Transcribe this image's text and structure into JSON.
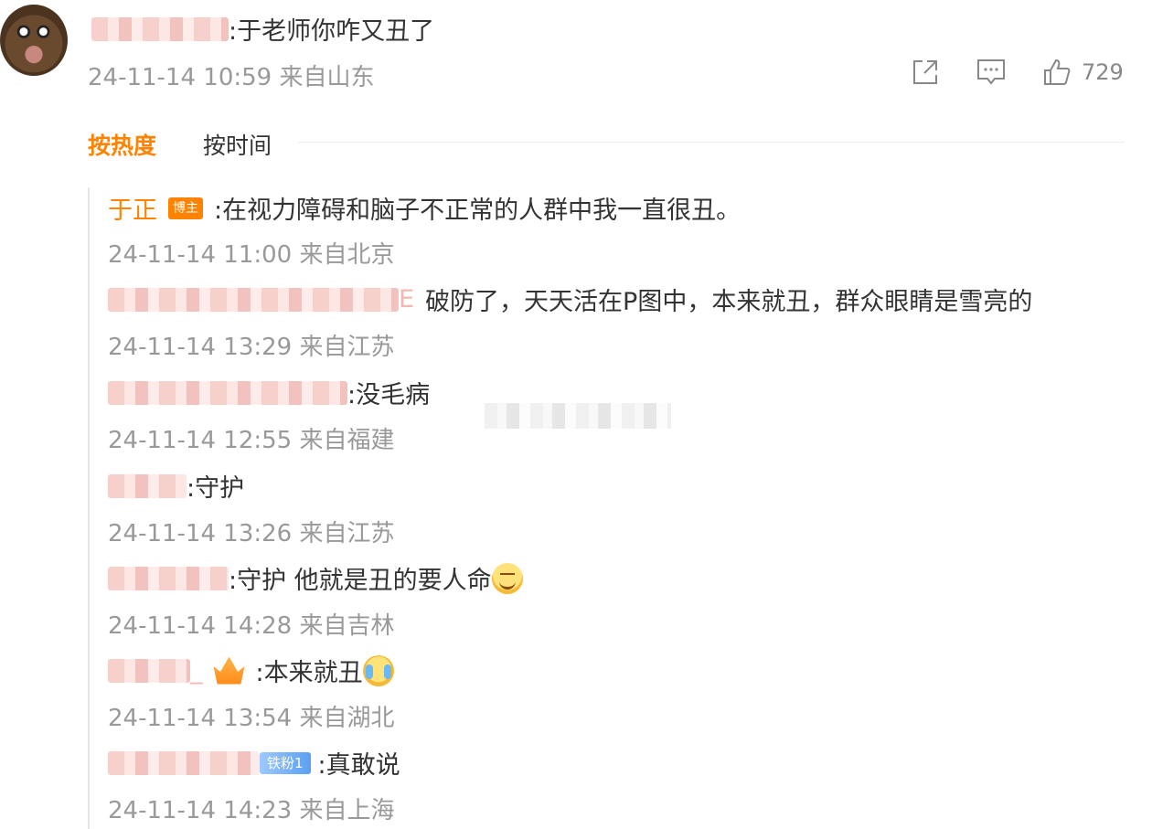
{
  "comment": {
    "text": ":于老师你咋又丑了",
    "meta": "24-11-14 10:59 来自山东",
    "like_count": "729",
    "icons": [
      "share-icon",
      "comment-icon",
      "thumbs-up-icon"
    ]
  },
  "sort": {
    "hot_label": "按热度",
    "time_label": "按时间"
  },
  "replies": [
    {
      "author": "于正",
      "badge": "博主",
      "text": ":在视力障碍和脑子不正常的人群中我一直很丑。",
      "meta": "24-11-14 11:00 来自北京"
    },
    {
      "author_suffix": "E",
      "text": "破防了，天天活在P图中，本来就丑，群众眼睛是雪亮的",
      "meta": "24-11-14 13:29 来自江苏"
    },
    {
      "text": ":没毛病",
      "meta": "24-11-14 12:55 来自福建"
    },
    {
      "text": ":守护",
      "meta": "24-11-14 13:26 来自江苏"
    },
    {
      "text": ":守护 他就是丑的要人命",
      "meta": "24-11-14 14:28 来自吉林",
      "emoji": "smile-emoji"
    },
    {
      "author_suffix": "_",
      "text": ":本来就丑",
      "meta": "24-11-14 13:54 来自湖北",
      "emoji": "cry-emoji"
    },
    {
      "badge": "铁粉1",
      "text": ":真敢说",
      "meta": "24-11-14 14:23 来自上海"
    }
  ]
}
